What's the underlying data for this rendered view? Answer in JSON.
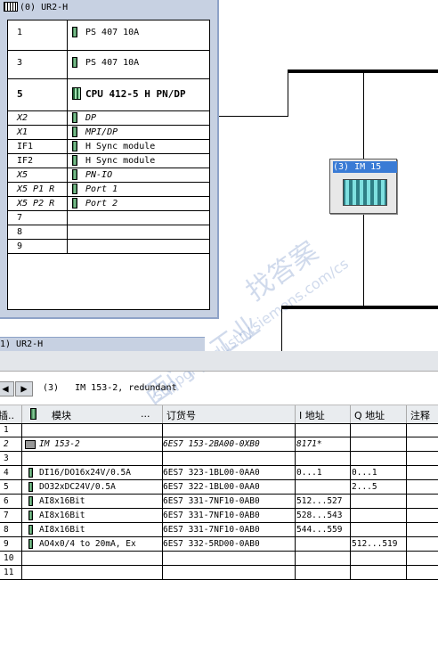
{
  "rack": {
    "title": "(0) UR2-H",
    "rows": [
      {
        "slot": "1",
        "module": "PS 407 10A"
      },
      {
        "slot": "3",
        "module": "PS 407 10A"
      },
      {
        "slot": "5",
        "module": "CPU 412-5 H PN/DP"
      },
      {
        "slot": "X2",
        "module": "DP"
      },
      {
        "slot": "X1",
        "module": "MPI/DP"
      },
      {
        "slot": "IF1",
        "module": "H Sync module"
      },
      {
        "slot": "IF2",
        "module": "H Sync module"
      },
      {
        "slot": "X5",
        "module": "PN-IO"
      },
      {
        "slot": "X5 P1 R",
        "module": "Port 1"
      },
      {
        "slot": "X5 P2 R",
        "module": "Port 2"
      },
      {
        "slot": "7",
        "module": ""
      },
      {
        "slot": "8",
        "module": ""
      },
      {
        "slot": "9",
        "module": ""
      }
    ]
  },
  "im_node": {
    "title": "(3) IM 15"
  },
  "second_rack": {
    "title": "1) UR2-H"
  },
  "detail": {
    "nav_label": "(3)   IM 153-2, redundant",
    "headers": {
      "slot": "插..",
      "module": "模块",
      "order": "订货号",
      "iaddr": "I 地址",
      "qaddr": "Q 地址",
      "comment": "注释"
    },
    "rows": [
      {
        "slot": "1",
        "module": "",
        "order": "",
        "i": "",
        "q": "",
        "icon": ""
      },
      {
        "slot": "2",
        "module": "IM 153-2",
        "order": "6ES7 153-2BA00-0XB0",
        "i": "8171*",
        "q": "",
        "icon": "im-icon"
      },
      {
        "slot": "3",
        "module": "",
        "order": "",
        "i": "",
        "q": "",
        "icon": ""
      },
      {
        "slot": "4",
        "module": "DI16/DO16x24V/0.5A",
        "order": "6ES7 323-1BL00-0AA0",
        "i": "0...1",
        "q": "0...1",
        "icon": "module-icon"
      },
      {
        "slot": "5",
        "module": "DO32xDC24V/0.5A",
        "order": "6ES7 322-1BL00-0AA0",
        "i": "",
        "q": "2...5",
        "icon": "module-icon"
      },
      {
        "slot": "6",
        "module": "AI8x16Bit",
        "order": "6ES7 331-7NF10-0AB0",
        "i": "512...527",
        "q": "",
        "icon": "module-icon"
      },
      {
        "slot": "7",
        "module": "AI8x16Bit",
        "order": "6ES7 331-7NF10-0AB0",
        "i": "528...543",
        "q": "",
        "icon": "module-icon"
      },
      {
        "slot": "8",
        "module": "AI8x16Bit",
        "order": "6ES7 331-7NF10-0AB0",
        "i": "544...559",
        "q": "",
        "icon": "module-icon"
      },
      {
        "slot": "9",
        "module": "AO4x0/4 to 20mA, Ex",
        "order": "6ES7 332-5RD00-0AB0",
        "i": "",
        "q": "512...519",
        "icon": "module-icon"
      },
      {
        "slot": "10",
        "module": "",
        "order": "",
        "i": "",
        "q": "",
        "icon": ""
      },
      {
        "slot": "11",
        "module": "",
        "order": "",
        "i": "",
        "q": "",
        "icon": ""
      }
    ]
  },
  "watermark": {
    "line1": "西门子工业",
    "line2": "找答案",
    "line3": "support.industry.siemens.com/cs"
  }
}
